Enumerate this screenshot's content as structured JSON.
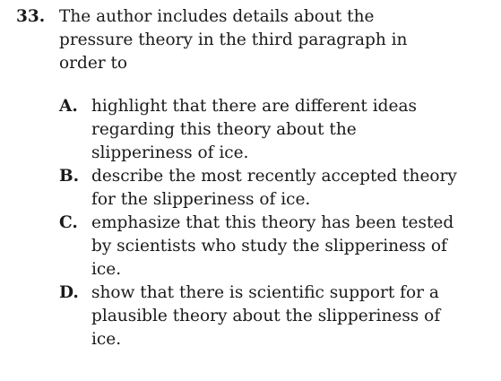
{
  "question": {
    "number": "33.",
    "stem": "The author includes details about the pressure theory in the third paragraph in order to",
    "choices": [
      {
        "letter": "A.",
        "text": "highlight that there are different ideas regarding this theory about the slipperiness of ice."
      },
      {
        "letter": "B.",
        "text": "describe the most recently accepted theory for the slipperiness of ice."
      },
      {
        "letter": "C.",
        "text": "emphasize that this theory has been tested by scientists who study the slipperiness of ice."
      },
      {
        "letter": "D.",
        "text": "show that there is scientific support for a plausible theory about the slipperiness of ice."
      }
    ]
  }
}
